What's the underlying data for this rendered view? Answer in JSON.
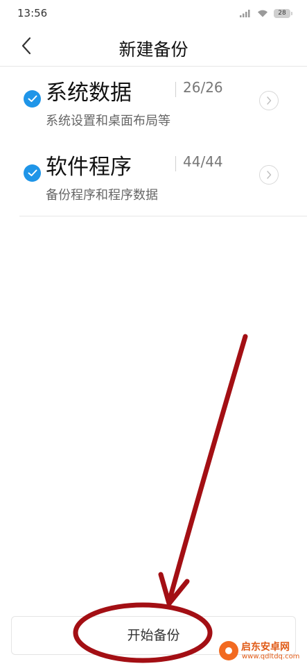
{
  "status_bar": {
    "time": "13:56",
    "battery": "28",
    "icons": [
      "signal-icon",
      "wifi-icon",
      "battery-icon"
    ]
  },
  "header": {
    "title": "新建备份",
    "back_icon": "chevron-left-icon"
  },
  "backup_items": [
    {
      "name": "系统数据",
      "count": "26/26",
      "description": "系统设置和桌面布局等",
      "checked": true
    },
    {
      "name": "软件程序",
      "count": "44/44",
      "description": "备份程序和程序数据",
      "checked": true
    }
  ],
  "bottom_bar": {
    "start_label": "开始备份"
  },
  "annotation": {
    "color": "#a30f14",
    "shapes": [
      "arrow",
      "ellipse"
    ]
  },
  "watermark": {
    "name": "启东安卓网",
    "url": "www.qdltdq.com"
  },
  "colors": {
    "accent": "#1f95e8",
    "annotation": "#a30f14",
    "watermark": "#e05a16"
  }
}
